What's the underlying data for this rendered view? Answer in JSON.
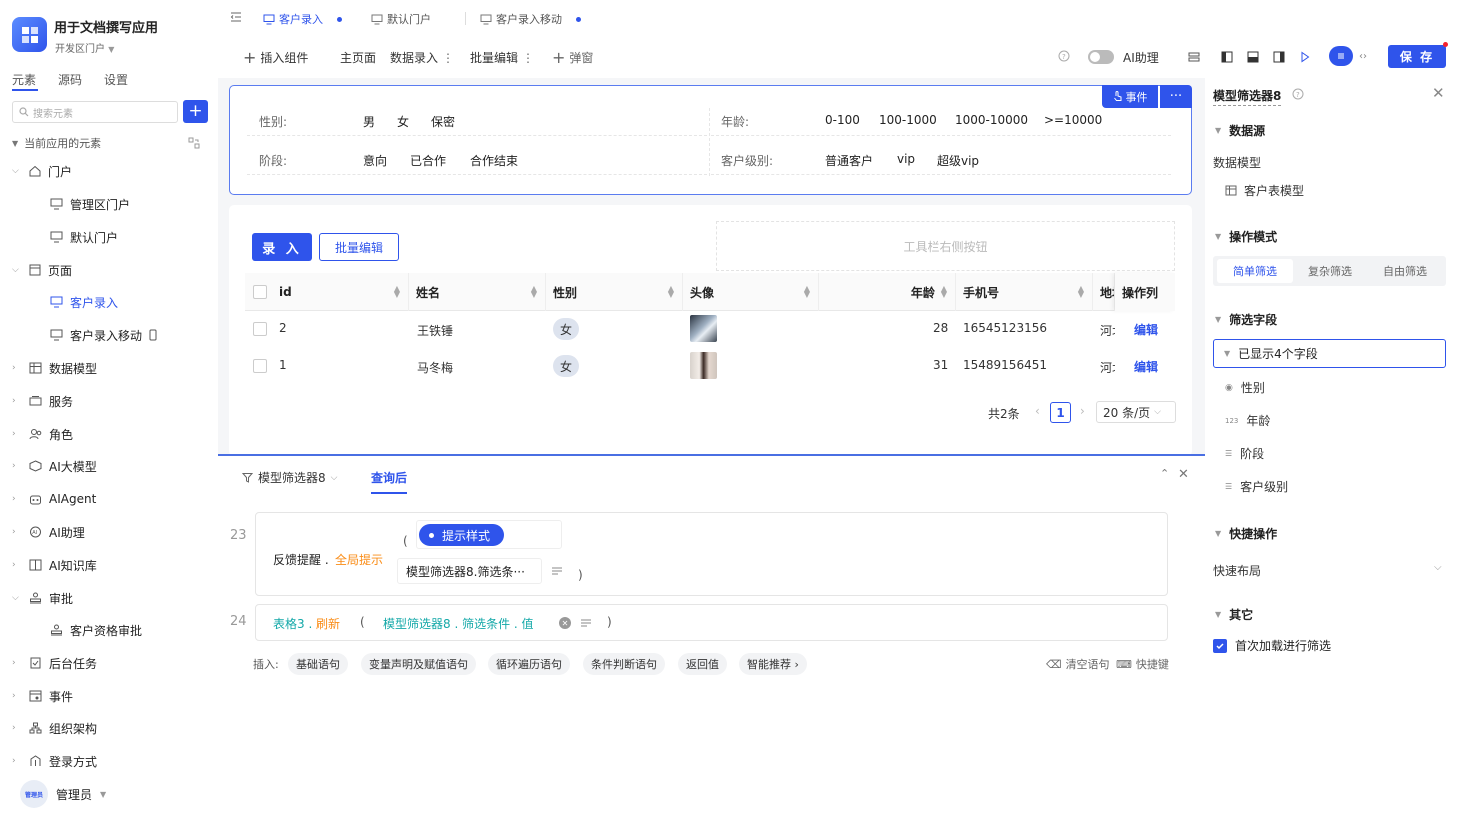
{
  "app": {
    "name": "用于文档撰写应用",
    "workspace": "开发区门户"
  },
  "sidebar": {
    "tabs": [
      "元素",
      "源码",
      "设置"
    ],
    "search_placeholder": "搜索元素",
    "add_label": "+",
    "current_header": "当前应用的元素",
    "items": [
      {
        "label": "门户",
        "icon": "home-icon"
      },
      {
        "label": "管理区门户",
        "icon": "monitor-icon"
      },
      {
        "label": "默认门户",
        "icon": "monitor-icon"
      },
      {
        "label": "页面",
        "icon": "page-icon"
      },
      {
        "label": "客户录入",
        "icon": "monitor-icon"
      },
      {
        "label": "客户录入移动",
        "icon": "monitor-icon"
      },
      {
        "label": "数据模型",
        "icon": "table-icon"
      },
      {
        "label": "服务",
        "icon": "service-icon"
      },
      {
        "label": "角色",
        "icon": "users-icon"
      },
      {
        "label": "AI大模型",
        "icon": "cube-icon"
      },
      {
        "label": "AIAgent",
        "icon": "robot-icon"
      },
      {
        "label": "AI助理",
        "icon": "ai-icon"
      },
      {
        "label": "AI知识库",
        "icon": "book-icon"
      },
      {
        "label": "审批",
        "icon": "stamp-icon"
      },
      {
        "label": "客户资格审批",
        "icon": "stamp-icon"
      },
      {
        "label": "后台任务",
        "icon": "task-icon"
      },
      {
        "label": "事件",
        "icon": "event-icon"
      },
      {
        "label": "组织架构",
        "icon": "org-icon"
      },
      {
        "label": "登录方式",
        "icon": "login-icon"
      }
    ],
    "user": {
      "name": "管理员",
      "avatar_text": "管理员"
    }
  },
  "tabs": [
    {
      "label": "客户录入",
      "dot": true
    },
    {
      "label": "默认门户",
      "dot": false
    },
    {
      "label": "客户录入移动",
      "dot": true
    }
  ],
  "toolbar": {
    "insert": "插入组件",
    "main_page": "主页面",
    "data_entry": "数据录入",
    "batch_edit": "批量编辑",
    "popup": "弹窗",
    "ai_assistant": "AI助理",
    "save": "保 存"
  },
  "filter": {
    "event_label": "事件",
    "more_label": "···",
    "rows": [
      {
        "label": "性别:",
        "options": [
          "男",
          "女",
          "保密"
        ]
      },
      {
        "label": "年龄:",
        "options": [
          "0-100",
          "100-1000",
          "1000-10000",
          ">=10000"
        ]
      },
      {
        "label": "阶段:",
        "options": [
          "意向",
          "已合作",
          "合作结束"
        ]
      },
      {
        "label": "客户级别:",
        "options": [
          "普通客户",
          "vip",
          "超级vip"
        ]
      }
    ]
  },
  "table": {
    "entry_btn": "录 入",
    "batch_btn": "批量编辑",
    "toolbar_right": "工具栏右侧按钮",
    "columns": [
      "id",
      "姓名",
      "性别",
      "头像",
      "年龄",
      "手机号",
      "地址",
      "操作列"
    ],
    "rows": [
      {
        "id": "2",
        "name": "王铁锤",
        "gender": "女",
        "age": "28",
        "phone": "16545123156",
        "addr": "河北",
        "action": "编辑"
      },
      {
        "id": "1",
        "name": "马冬梅",
        "gender": "女",
        "age": "31",
        "phone": "15489156451",
        "addr": "河北",
        "action": "编辑"
      }
    ],
    "total": "共2条",
    "page": "1",
    "page_size": "20 条/页"
  },
  "code": {
    "component": "模型筛选器8",
    "event_tab": "查询后",
    "lines": [
      {
        "no": "23",
        "call": "反馈提醒 .",
        "method": "全局提示",
        "paren_open": "(",
        "param_label": "提示样式",
        "param_value": "模型筛选器8.筛选条···",
        "paren_close": ")"
      },
      {
        "no": "24",
        "obj": "表格3 .",
        "method": "刷新",
        "paren_open": "(",
        "arg": "模型筛选器8 . 筛选条件 . 值",
        "paren_close": ")"
      }
    ],
    "insert_label": "插入:",
    "insert_chips": [
      "基础语句",
      "变量声明及赋值语句",
      "循环遍历语句",
      "条件判断语句",
      "返回值",
      "智能推荐 ›"
    ],
    "clear": "清空语句",
    "shortcut": "快捷键"
  },
  "right_panel": {
    "title": "模型筛选器8",
    "data_source": "数据源",
    "data_model_label": "数据模型",
    "data_model": "客户表模型",
    "op_mode": "操作模式",
    "modes": [
      "简单筛选",
      "复杂筛选",
      "自由筛选"
    ],
    "filter_fields": "筛选字段",
    "shown_fields": "已显示4个字段",
    "fields": [
      "性别",
      "年龄",
      "阶段",
      "客户级别"
    ],
    "quick_ops": "快捷操作",
    "quick_layout": "快速布局",
    "other": "其它",
    "first_load": "首次加载进行筛选"
  },
  "colors": {
    "primary": "#2f54eb",
    "orange": "#fa8c16",
    "teal": "#13a8a8"
  }
}
